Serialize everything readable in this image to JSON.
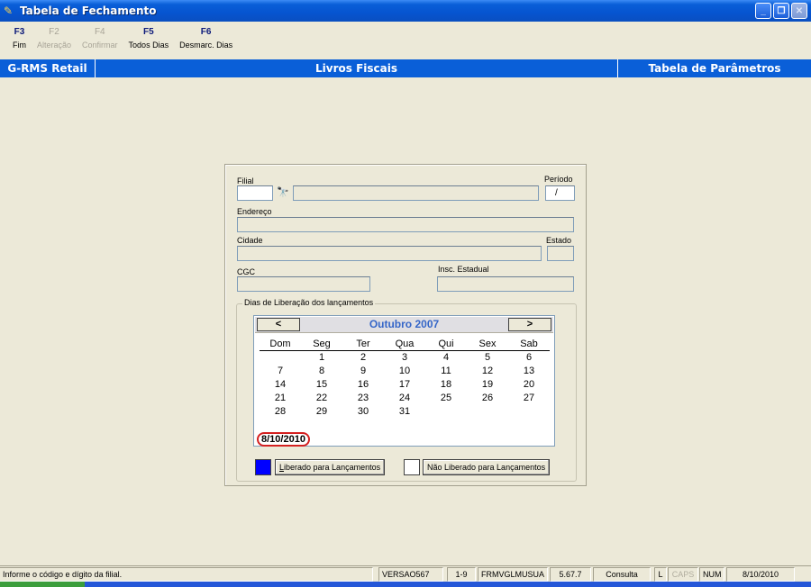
{
  "window": {
    "title": "Tabela de Fechamento"
  },
  "toolbar": {
    "items": [
      {
        "key": "F3",
        "label": "Fim",
        "enabled": true
      },
      {
        "key": "F2",
        "label": "Alteração",
        "enabled": false
      },
      {
        "key": "F4",
        "label": "Confirmar",
        "enabled": false
      },
      {
        "key": "F5",
        "label": "Todos Dias",
        "enabled": true
      },
      {
        "key": "F6",
        "label": "Desmarc. Dias",
        "enabled": true
      }
    ]
  },
  "header": {
    "left": "G-RMS Retail",
    "center": "Livros Fiscais",
    "right": "Tabela de Parâmetros"
  },
  "form": {
    "filial_label": "Filial",
    "filial_value": "",
    "periodo_label": "Período",
    "periodo_value": "/",
    "endereco_label": "Endereço",
    "cidade_label": "Cidade",
    "estado_label": "Estado",
    "cgc_label": "CGC",
    "insc_label": "Insc. Estadual",
    "group_label": "Dias de Liberação dos lançamentos"
  },
  "calendar": {
    "month_title": "Outubro 2007",
    "prev": "<",
    "next": ">",
    "weekdays": [
      "Dom",
      "Seg",
      "Ter",
      "Qua",
      "Qui",
      "Sex",
      "Sab"
    ],
    "weeks": [
      [
        "",
        "1",
        "2",
        "3",
        "4",
        "5",
        "6"
      ],
      [
        "7",
        "8",
        "9",
        "10",
        "11",
        "12",
        "13"
      ],
      [
        "14",
        "15",
        "16",
        "17",
        "18",
        "19",
        "20"
      ],
      [
        "21",
        "22",
        "23",
        "24",
        "25",
        "26",
        "27"
      ],
      [
        "28",
        "29",
        "30",
        "31",
        "",
        "",
        ""
      ]
    ],
    "today": "8/10/2010"
  },
  "legend": {
    "liberado": "Liberado para Lançamentos",
    "nao_liberado": "Não Liberado para Lançamentos",
    "liberado_color": "#0000ff",
    "nao_liberado_color": "#ffffff"
  },
  "statusbar": {
    "message": "Informe o código e dígito da filial.",
    "versao": "VERSAO567",
    "pos": "1-9",
    "form": "FRMVGLMUSUA",
    "build": "5.67.7",
    "mode": "Consulta",
    "l": "L",
    "caps": "CAPS",
    "num": "NUM",
    "date": "8/10/2010"
  }
}
